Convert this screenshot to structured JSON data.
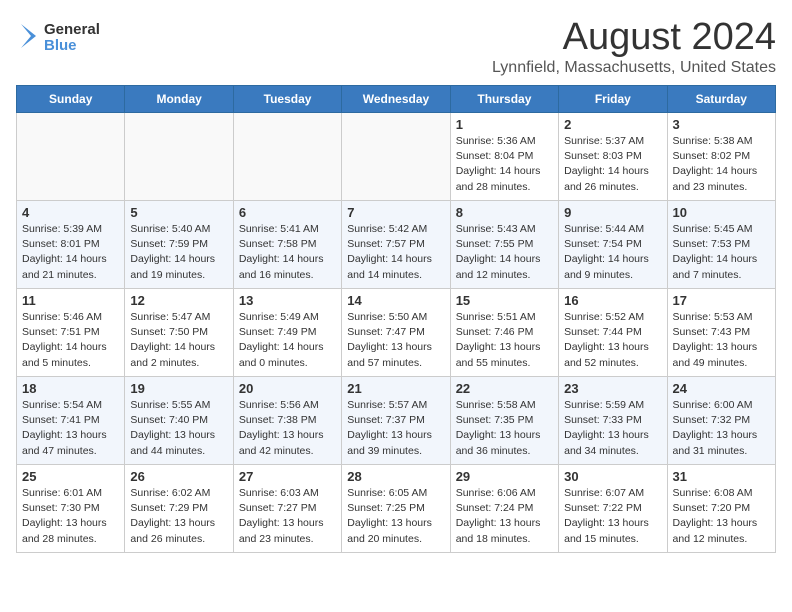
{
  "header": {
    "logo_general": "General",
    "logo_blue": "Blue",
    "month": "August 2024",
    "location": "Lynnfield, Massachusetts, United States"
  },
  "weekdays": [
    "Sunday",
    "Monday",
    "Tuesday",
    "Wednesday",
    "Thursday",
    "Friday",
    "Saturday"
  ],
  "weeks": [
    [
      {
        "day": "",
        "info": ""
      },
      {
        "day": "",
        "info": ""
      },
      {
        "day": "",
        "info": ""
      },
      {
        "day": "",
        "info": ""
      },
      {
        "day": "1",
        "info": "Sunrise: 5:36 AM\nSunset: 8:04 PM\nDaylight: 14 hours\nand 28 minutes."
      },
      {
        "day": "2",
        "info": "Sunrise: 5:37 AM\nSunset: 8:03 PM\nDaylight: 14 hours\nand 26 minutes."
      },
      {
        "day": "3",
        "info": "Sunrise: 5:38 AM\nSunset: 8:02 PM\nDaylight: 14 hours\nand 23 minutes."
      }
    ],
    [
      {
        "day": "4",
        "info": "Sunrise: 5:39 AM\nSunset: 8:01 PM\nDaylight: 14 hours\nand 21 minutes."
      },
      {
        "day": "5",
        "info": "Sunrise: 5:40 AM\nSunset: 7:59 PM\nDaylight: 14 hours\nand 19 minutes."
      },
      {
        "day": "6",
        "info": "Sunrise: 5:41 AM\nSunset: 7:58 PM\nDaylight: 14 hours\nand 16 minutes."
      },
      {
        "day": "7",
        "info": "Sunrise: 5:42 AM\nSunset: 7:57 PM\nDaylight: 14 hours\nand 14 minutes."
      },
      {
        "day": "8",
        "info": "Sunrise: 5:43 AM\nSunset: 7:55 PM\nDaylight: 14 hours\nand 12 minutes."
      },
      {
        "day": "9",
        "info": "Sunrise: 5:44 AM\nSunset: 7:54 PM\nDaylight: 14 hours\nand 9 minutes."
      },
      {
        "day": "10",
        "info": "Sunrise: 5:45 AM\nSunset: 7:53 PM\nDaylight: 14 hours\nand 7 minutes."
      }
    ],
    [
      {
        "day": "11",
        "info": "Sunrise: 5:46 AM\nSunset: 7:51 PM\nDaylight: 14 hours\nand 5 minutes."
      },
      {
        "day": "12",
        "info": "Sunrise: 5:47 AM\nSunset: 7:50 PM\nDaylight: 14 hours\nand 2 minutes."
      },
      {
        "day": "13",
        "info": "Sunrise: 5:49 AM\nSunset: 7:49 PM\nDaylight: 14 hours\nand 0 minutes."
      },
      {
        "day": "14",
        "info": "Sunrise: 5:50 AM\nSunset: 7:47 PM\nDaylight: 13 hours\nand 57 minutes."
      },
      {
        "day": "15",
        "info": "Sunrise: 5:51 AM\nSunset: 7:46 PM\nDaylight: 13 hours\nand 55 minutes."
      },
      {
        "day": "16",
        "info": "Sunrise: 5:52 AM\nSunset: 7:44 PM\nDaylight: 13 hours\nand 52 minutes."
      },
      {
        "day": "17",
        "info": "Sunrise: 5:53 AM\nSunset: 7:43 PM\nDaylight: 13 hours\nand 49 minutes."
      }
    ],
    [
      {
        "day": "18",
        "info": "Sunrise: 5:54 AM\nSunset: 7:41 PM\nDaylight: 13 hours\nand 47 minutes."
      },
      {
        "day": "19",
        "info": "Sunrise: 5:55 AM\nSunset: 7:40 PM\nDaylight: 13 hours\nand 44 minutes."
      },
      {
        "day": "20",
        "info": "Sunrise: 5:56 AM\nSunset: 7:38 PM\nDaylight: 13 hours\nand 42 minutes."
      },
      {
        "day": "21",
        "info": "Sunrise: 5:57 AM\nSunset: 7:37 PM\nDaylight: 13 hours\nand 39 minutes."
      },
      {
        "day": "22",
        "info": "Sunrise: 5:58 AM\nSunset: 7:35 PM\nDaylight: 13 hours\nand 36 minutes."
      },
      {
        "day": "23",
        "info": "Sunrise: 5:59 AM\nSunset: 7:33 PM\nDaylight: 13 hours\nand 34 minutes."
      },
      {
        "day": "24",
        "info": "Sunrise: 6:00 AM\nSunset: 7:32 PM\nDaylight: 13 hours\nand 31 minutes."
      }
    ],
    [
      {
        "day": "25",
        "info": "Sunrise: 6:01 AM\nSunset: 7:30 PM\nDaylight: 13 hours\nand 28 minutes."
      },
      {
        "day": "26",
        "info": "Sunrise: 6:02 AM\nSunset: 7:29 PM\nDaylight: 13 hours\nand 26 minutes."
      },
      {
        "day": "27",
        "info": "Sunrise: 6:03 AM\nSunset: 7:27 PM\nDaylight: 13 hours\nand 23 minutes."
      },
      {
        "day": "28",
        "info": "Sunrise: 6:05 AM\nSunset: 7:25 PM\nDaylight: 13 hours\nand 20 minutes."
      },
      {
        "day": "29",
        "info": "Sunrise: 6:06 AM\nSunset: 7:24 PM\nDaylight: 13 hours\nand 18 minutes."
      },
      {
        "day": "30",
        "info": "Sunrise: 6:07 AM\nSunset: 7:22 PM\nDaylight: 13 hours\nand 15 minutes."
      },
      {
        "day": "31",
        "info": "Sunrise: 6:08 AM\nSunset: 7:20 PM\nDaylight: 13 hours\nand 12 minutes."
      }
    ]
  ]
}
